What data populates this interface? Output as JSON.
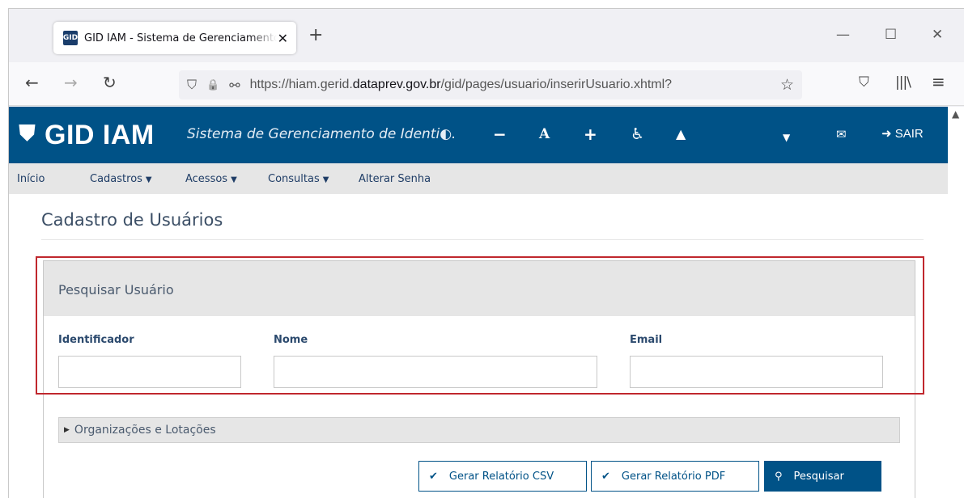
{
  "browser": {
    "tab": {
      "favicon_text": "GID",
      "title": "GID IAM - Sistema de Gerenciamento de Identidades",
      "close_glyph": "✕"
    },
    "new_tab_glyph": "+",
    "window_controls": {
      "minimize": "—",
      "maximize": "☐",
      "close": "✕"
    },
    "nav": {
      "back": "←",
      "forward": "→",
      "reload": "↻"
    },
    "url": {
      "prefix": "https://hiam.gerid.",
      "domain": "dataprev.gov.br",
      "path": "/gid/pages/usuario/inserirUsuario.xhtml?",
      "shield_icon": "⛉",
      "lock_icon": "🔒",
      "perm_icon": "⚯",
      "star": "☆"
    },
    "toolbar": {
      "pocket": "⛉",
      "library": "|||\\",
      "menu": "≡"
    }
  },
  "header": {
    "logo_shield": "⛊",
    "logo_text": "GID IAM",
    "subtitle": "Sistema de Gerenciamento de Identi◐...",
    "controls": {
      "decrease_font": "−",
      "reset_font": "A",
      "increase_font": "+",
      "accessibility": "♿",
      "user": "▲",
      "caret": "▼",
      "mail": "✉"
    },
    "logout_label": "SAIR",
    "logout_icon": "➜"
  },
  "menu": {
    "inicio": "Início",
    "cadastros": "Cadastros",
    "acessos": "Acessos",
    "consultas": "Consultas",
    "alterar_senha": "Alterar Senha",
    "caret": "▼"
  },
  "page": {
    "title": "Cadastro de Usuários"
  },
  "search_panel": {
    "title": "Pesquisar Usuário",
    "fields": {
      "identificador": {
        "label": "Identificador",
        "value": "",
        "placeholder": ""
      },
      "nome": {
        "label": "Nome",
        "value": "",
        "placeholder": ""
      },
      "email": {
        "label": "Email",
        "value": "",
        "placeholder": ""
      }
    },
    "collapsible": {
      "label": "Organizações e Lotações",
      "glyph": "▶"
    },
    "buttons": {
      "csv": {
        "label": "Gerar Relatório CSV",
        "icon": "✔"
      },
      "pdf": {
        "label": "Gerar Relatório PDF",
        "icon": "✔"
      },
      "search": {
        "label": "Pesquisar",
        "icon": "⚲"
      }
    }
  },
  "colors": {
    "header_blue": "#005287",
    "highlight_red": "#c0272d",
    "menu_gray": "#e6e6e6"
  }
}
